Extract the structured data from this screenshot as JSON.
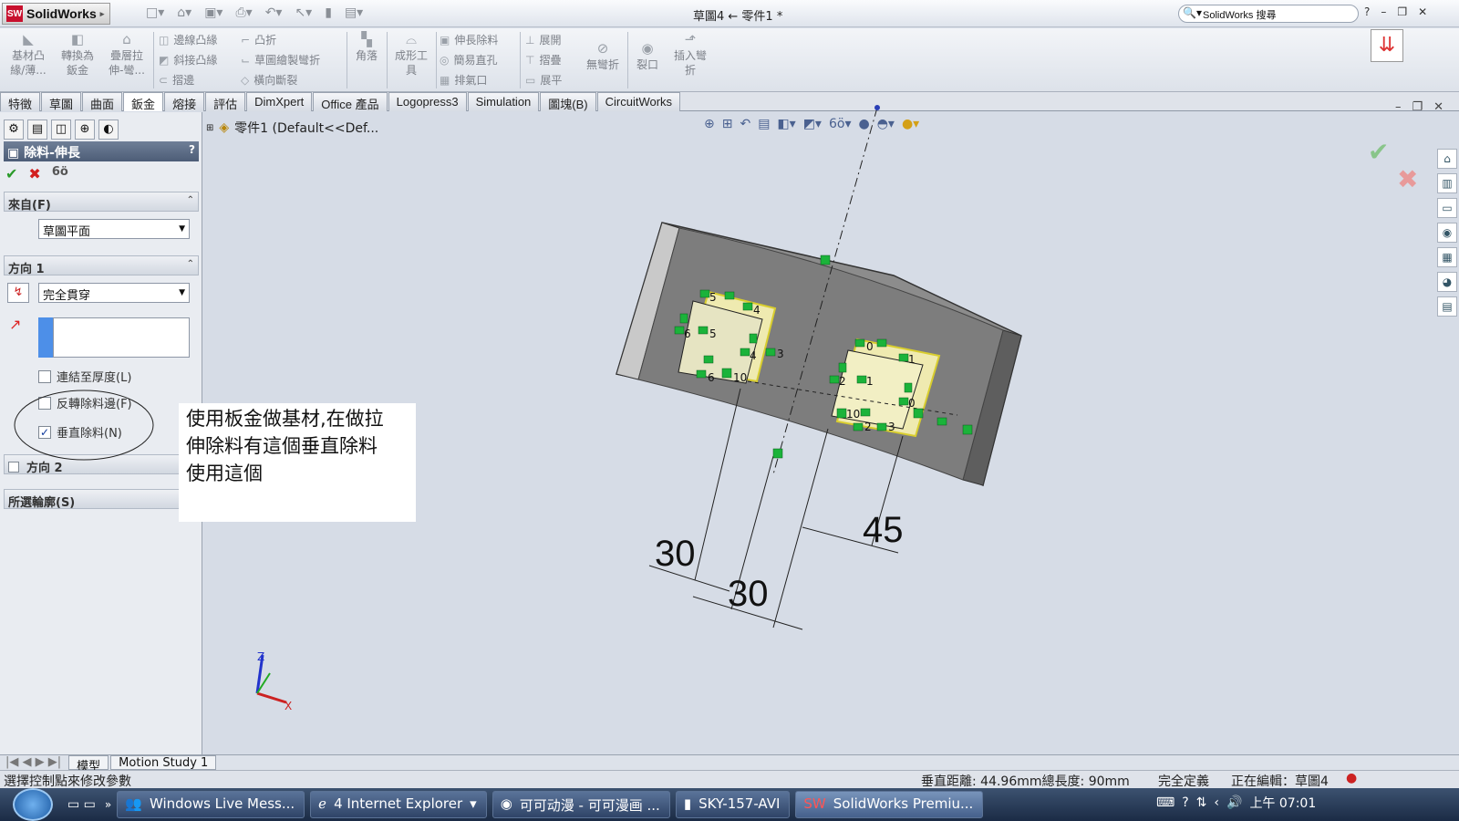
{
  "titlebar": {
    "app": "SolidWorks",
    "doc_title": "草圖4 ← 零件1 *",
    "search_placeholder": "SolidWorks 搜尋",
    "help": "?",
    "win_min": "–",
    "win_restore": "❐",
    "win_close": "✕"
  },
  "ribbon": {
    "big": [
      {
        "icon": "sheetmetal-base-icon",
        "l1": "基材凸",
        "l2": "緣/薄..."
      },
      {
        "icon": "convert-icon",
        "l1": "轉換為",
        "l2": "鈑金"
      },
      {
        "icon": "lofted-bend-icon",
        "l1": "疊層拉",
        "l2": "伸-彎..."
      }
    ],
    "small_col1": [
      "邊線凸緣",
      "斜接凸緣",
      "摺邊"
    ],
    "small_col2": [
      "凸折",
      "草圖繪製彎折",
      "橫向斷裂"
    ],
    "corner": "角落",
    "forming": {
      "l1": "成形工",
      "l2": "具"
    },
    "small_col3": [
      "伸長除料",
      "簡易直孔",
      "排氣口"
    ],
    "small_col4": [
      "展開",
      "摺疊",
      "展平"
    ],
    "nobends": "無彎折",
    "rip": "裂口",
    "insertbend": {
      "l1": "插入彎",
      "l2": "折"
    }
  },
  "tabs": [
    "特徵",
    "草圖",
    "曲面",
    "鈑金",
    "熔接",
    "評估",
    "DimXpert",
    "Office 產品",
    "Logopress3",
    "Simulation",
    "圖塊(B)",
    "CircuitWorks"
  ],
  "active_tab": "鈑金",
  "pm": {
    "title": "除料-伸長",
    "help": "?",
    "from_label": "來自(F)",
    "from_value": "草圖平面",
    "dir1_label": "方向 1",
    "dir1_value": "完全貫穿",
    "link_thickness": "連結至厚度(L)",
    "flip_cut": "反轉除料邊(F)",
    "normal_cut": "垂直除料(N)",
    "dir2_label": "方向 2",
    "contours_label": "所選輪廓(S)"
  },
  "annotation": {
    "line1": "使用板金做基材,在做拉",
    "line2": "伸除料有這個垂直除料",
    "line3": "使用這個"
  },
  "tree": {
    "label": "零件1  (Default<<Def..."
  },
  "dims": {
    "d1": "30",
    "d2": "30",
    "d3": "45"
  },
  "sketch_labels": [
    "5",
    "4",
    "6",
    "5",
    "4",
    "3",
    "6",
    "10",
    "0",
    "1",
    "2",
    "1",
    "0",
    "10",
    "2",
    "3"
  ],
  "axes": {
    "z": "Z",
    "x": "X"
  },
  "bottom_tabs": [
    "模型",
    "Motion Study 1"
  ],
  "status": {
    "hint": "選擇控制點來修改參數",
    "measure": "垂直距離: 44.96mm總長度: 90mm",
    "defined": "完全定義",
    "editing": "正在編輯：草圖4"
  },
  "taskbar": [
    {
      "icon": "messenger-icon",
      "label": "Windows Live Mess..."
    },
    {
      "icon": "ie-icon",
      "label": "4 Internet Explorer"
    },
    {
      "icon": "firefox-icon",
      "label": "可可动漫 - 可可漫画 ..."
    },
    {
      "icon": "folder-icon",
      "label": "SKY-157-AVI"
    },
    {
      "icon": "solidworks-icon",
      "label": "SolidWorks Premiu..."
    }
  ],
  "tray": {
    "time": "上午 07:01",
    "overflow": "»"
  },
  "colors": {
    "accent": "#4d5d77",
    "part": "#8c8c8c",
    "sketch_green": "#1bb33a",
    "sketch_yellow": "#f0e13a"
  }
}
